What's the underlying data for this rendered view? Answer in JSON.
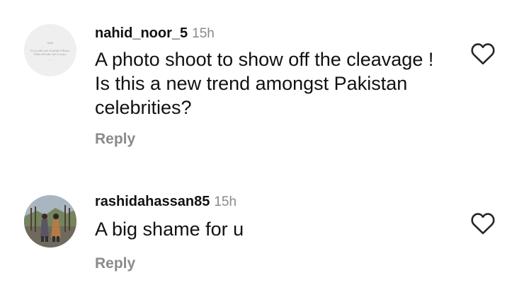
{
  "comments": [
    {
      "username": "nahid_noor_5",
      "time": "15h",
      "text": "A photo shoot to show off the cleavage ! Is this a new trend amongst Pakistan celebrities?",
      "reply_label": "Reply",
      "avatar": {
        "kind": "quote-image",
        "title": "Quilt",
        "body": "If you take care of people's Hearts, Allah will take care of yours.",
        "sign": "~ ~ ~"
      }
    },
    {
      "username": "rashidahassan85",
      "time": "15h",
      "text": "A big shame for u",
      "reply_label": "Reply",
      "avatar": {
        "kind": "photo"
      }
    }
  ],
  "icons": {
    "like": "heart-outline-icon"
  },
  "colors": {
    "text": "#111111",
    "muted": "#8a8a8a",
    "background": "#ffffff"
  }
}
